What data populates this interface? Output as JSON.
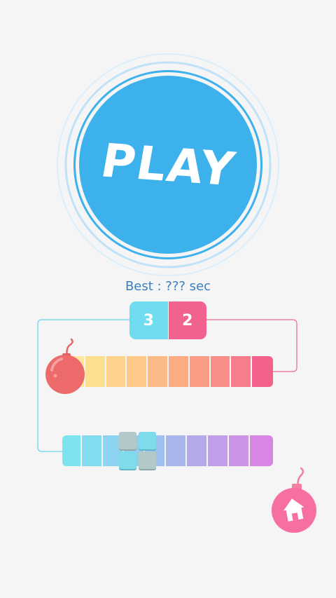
{
  "play": {
    "label": "PLAY"
  },
  "best": {
    "text": "Best : ??? sec"
  },
  "counter": {
    "left": "3",
    "right": "2"
  },
  "colors": {
    "play_blue": "#3cb1ec",
    "cyan": "#6fdcef",
    "pink": "#f2628e",
    "bomb_red": "#ec6a6a",
    "home_pink": "#f76ea0",
    "top_bar_gradient": [
      "#fde595",
      "#fdcb88",
      "#fba984",
      "#f98689",
      "#f76a8f",
      "#f45a8a"
    ],
    "bottom_bar_gradient": [
      "#7de3f1",
      "#8fd5ef",
      "#a3c3ee",
      "#b4aeea",
      "#c699e7",
      "#d886e3"
    ]
  },
  "icons": {
    "bomb": "bomb-icon",
    "home": "home-icon"
  }
}
